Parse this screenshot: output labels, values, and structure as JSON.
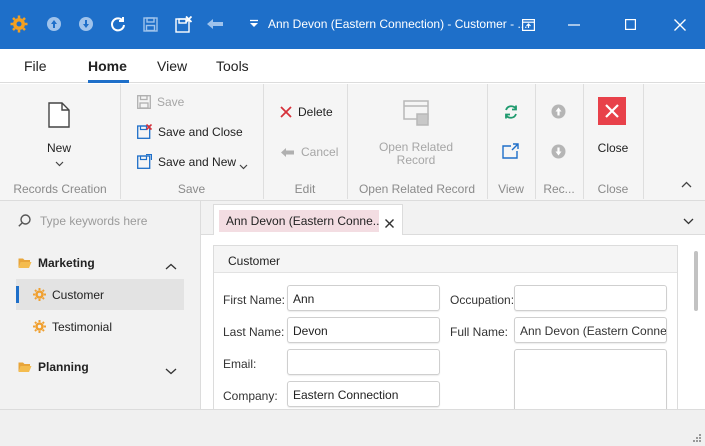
{
  "titlebar": {
    "title": "Ann Devon (Eastern Connection) - Customer - ...",
    "bg_color": "#1e6fc9",
    "icons": [
      "app-gear-icon",
      "arrow-up-circle-icon",
      "arrow-down-circle-icon",
      "refresh-icon",
      "save-icon",
      "save-close-icon",
      "undo-icon",
      "dropdown-icon",
      "restore-layout-icon",
      "minimize-icon",
      "maximize-icon",
      "close-icon"
    ]
  },
  "menu": {
    "tabs": [
      {
        "label": "File"
      },
      {
        "label": "Home"
      },
      {
        "label": "View"
      },
      {
        "label": "Tools"
      }
    ],
    "active": "Home"
  },
  "ribbon": {
    "groups": {
      "records_creation": "Records Creation",
      "save": "Save",
      "edit": "Edit",
      "open_related": "Open Related Record",
      "view": "View",
      "records": "Rec...",
      "close": "Close"
    },
    "new_label": "New",
    "save_label": "Save",
    "save_close_label": "Save and Close",
    "save_new_label": "Save and New",
    "delete_label": "Delete",
    "cancel_label": "Cancel",
    "open_related_label": "Open Related Record",
    "close_label": "Close"
  },
  "nav": {
    "search_placeholder": "Type keywords here",
    "groups": [
      {
        "label": "Marketing",
        "expanded": true,
        "items": [
          {
            "label": "Customer",
            "selected": true
          },
          {
            "label": "Testimonial",
            "selected": false
          }
        ]
      },
      {
        "label": "Planning",
        "expanded": false,
        "items": []
      }
    ]
  },
  "document": {
    "tab_label": "Ann Devon (Eastern Conne...",
    "section_title": "Customer",
    "fields": {
      "first_name": {
        "label": "First Name:",
        "value": "Ann"
      },
      "last_name": {
        "label": "Last Name:",
        "value": "Devon"
      },
      "email": {
        "label": "Email:",
        "value": ""
      },
      "company": {
        "label": "Company:",
        "value": "Eastern Connection"
      },
      "occupation": {
        "label": "Occupation:",
        "value": ""
      },
      "full_name": {
        "label": "Full Name:",
        "value": "Ann Devon (Eastern Connection)"
      }
    }
  }
}
